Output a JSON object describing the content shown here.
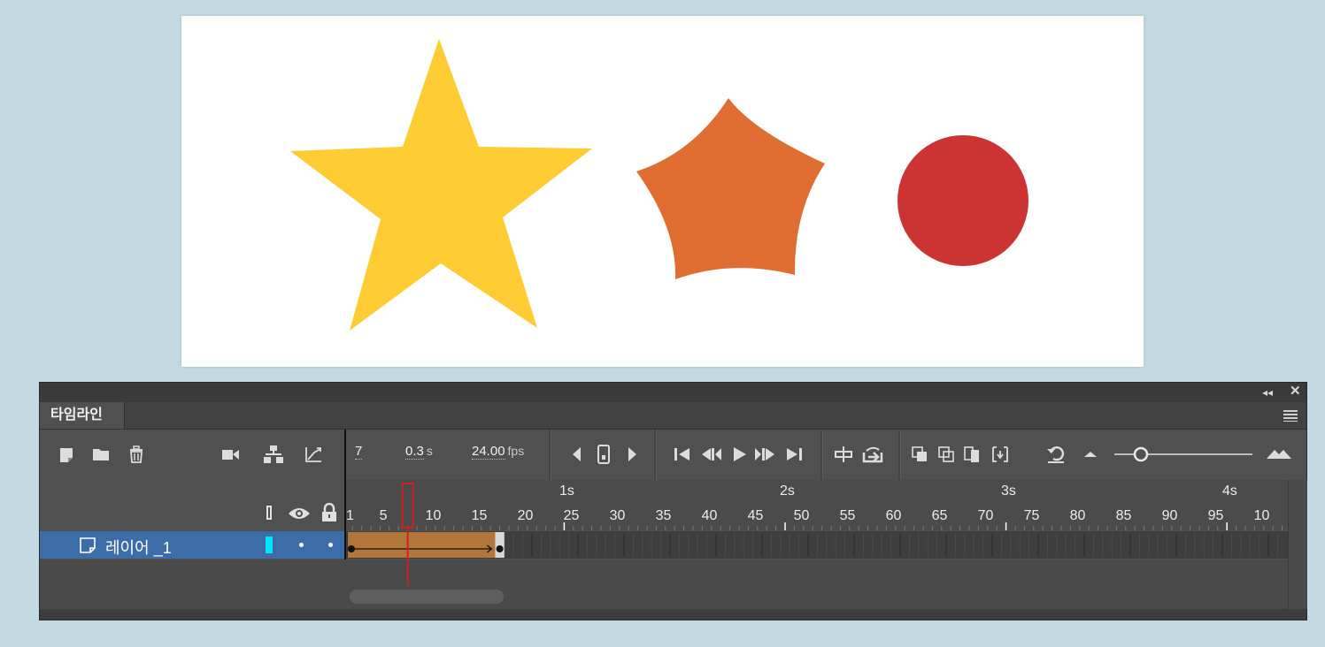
{
  "stage": {
    "background": "#ffffff",
    "shapes": [
      {
        "type": "star",
        "color": "#ffcc33"
      },
      {
        "type": "morphing-star",
        "color": "#e06d32"
      },
      {
        "type": "circle",
        "color": "#cc3333"
      }
    ]
  },
  "timeline": {
    "tab_label": "타임라인",
    "current_frame": "7",
    "current_time": "0.3",
    "time_unit": "s",
    "frame_rate": "24.00",
    "frame_rate_unit": "fps",
    "second_labels": [
      "1s",
      "2s",
      "3s",
      "4s"
    ],
    "frame_labels": [
      "1",
      "5",
      "10",
      "15",
      "20",
      "25",
      "30",
      "35",
      "40",
      "45",
      "50",
      "55",
      "60",
      "65",
      "70",
      "75",
      "80",
      "85",
      "90",
      "95",
      "10"
    ],
    "layer": {
      "name": "레이어 _1",
      "color": "#00e5ff",
      "tween_color": "#b3763a",
      "tween_start_frame": 1,
      "tween_end_frame": 17
    },
    "playhead_frame": 7,
    "colors": {
      "selection": "#3d6da8",
      "playhead": "#cc2222"
    }
  },
  "icons": {
    "collapse": "double-chevron-left-icon",
    "close": "close-icon",
    "panel_menu": "hamburger-menu-icon"
  }
}
